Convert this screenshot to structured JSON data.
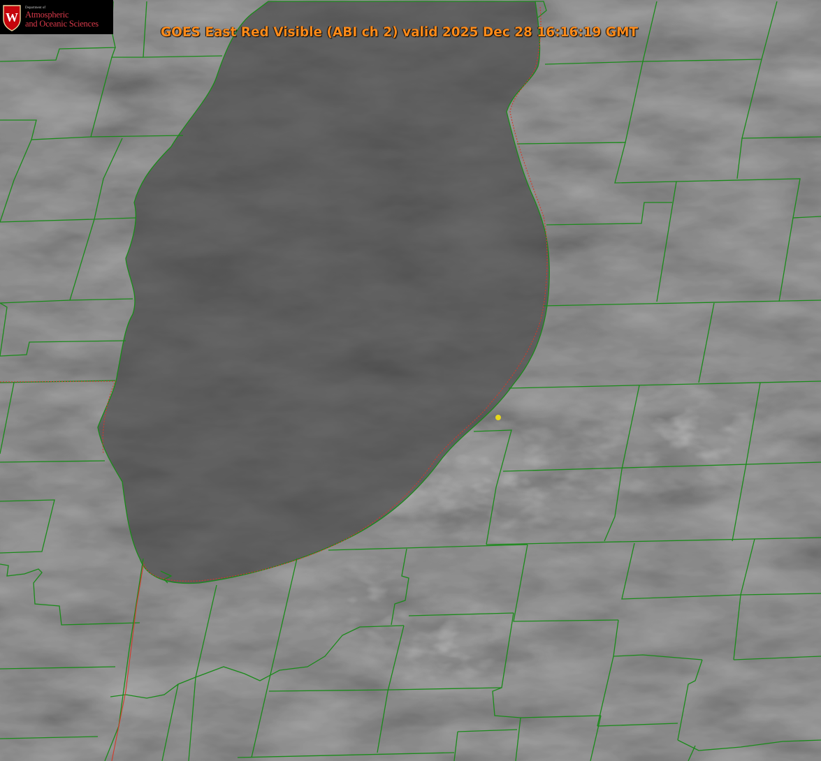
{
  "title": "GOES East Red Visible (ABI ch 2) valid 2025 Dec 28 16:16:19 GMT",
  "logo": {
    "crest_letter": "W",
    "department": "Department of",
    "line1": "Atmospheric",
    "line2": "and Oceanic Sciences"
  },
  "colors": {
    "background_cloud": "#4a4a4a",
    "lake": "#3f3f3f",
    "county_lines": "#1a8a1a",
    "state_line": "#d23a2a",
    "title_text": "#ff8b1a",
    "logo_red": "#d83a4a",
    "marker": "#e6d81c"
  },
  "map": {
    "marker_icon": "yellow-dot"
  }
}
